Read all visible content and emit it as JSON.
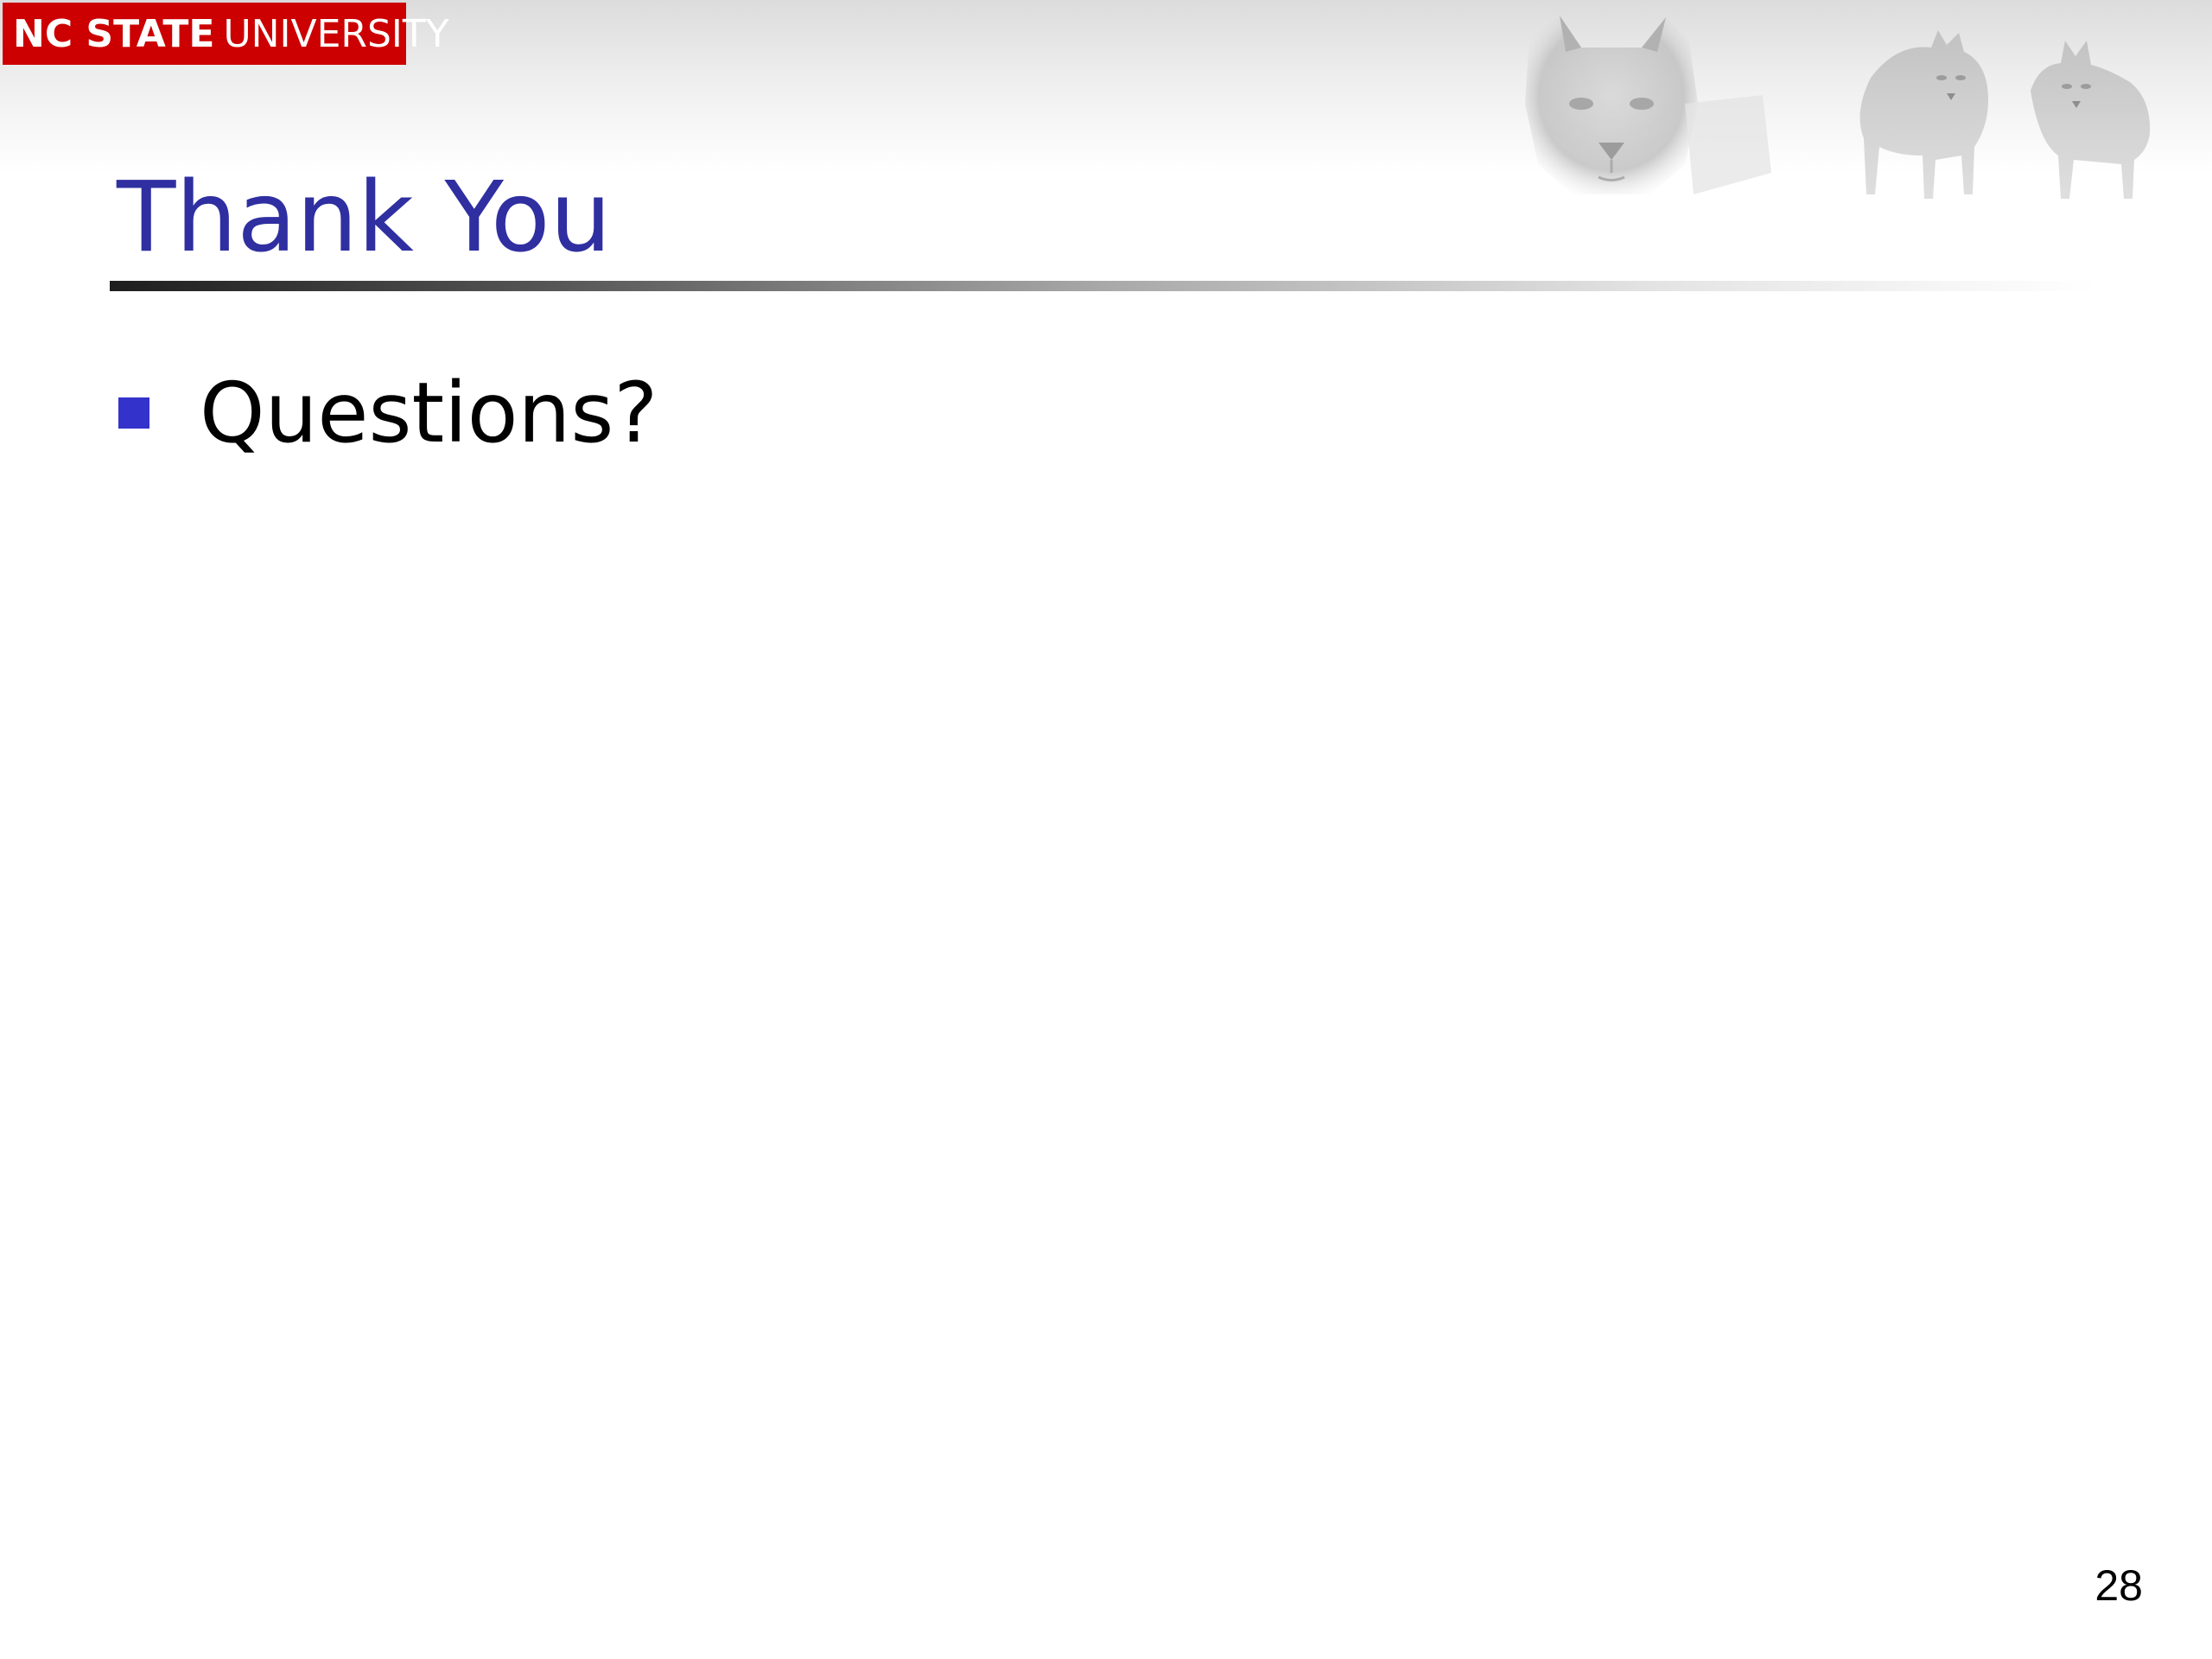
{
  "header": {
    "logo_bold": "NC STATE",
    "logo_thin": "UNIVERSITY",
    "logo_color": "#cc0000",
    "decoration": "wolves-image"
  },
  "slide": {
    "title": "Thank You",
    "title_color": "#2f2fa1",
    "bullets": [
      {
        "text": "Questions?"
      }
    ],
    "bullet_color": "#3333cc",
    "page_number": "28"
  }
}
